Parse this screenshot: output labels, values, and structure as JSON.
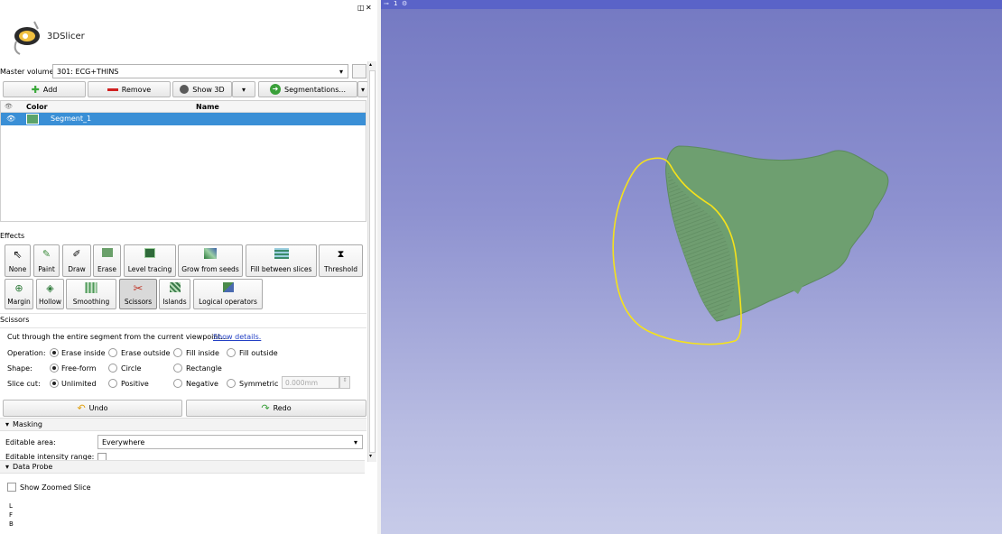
{
  "app": {
    "title": "3DSlicer"
  },
  "panel_controls": {
    "undock": "◫",
    "close": "✕"
  },
  "master_volume": {
    "label": "Master volume:",
    "value": "301: ECG+THINS"
  },
  "toolbar": {
    "add": "Add",
    "remove": "Remove",
    "show3d": "Show 3D",
    "segmentations": "Segmentations..."
  },
  "segments_table": {
    "columns": [
      "Color",
      "Name"
    ],
    "rows": [
      {
        "color": "#5aa36a",
        "name": "Segment_1"
      }
    ]
  },
  "effects": {
    "title": "Effects",
    "row1": [
      "None",
      "Paint",
      "Draw",
      "Erase",
      "Level tracing",
      "Grow from seeds",
      "Fill between slices",
      "Threshold"
    ],
    "row2": [
      "Margin",
      "Hollow",
      "Smoothing",
      "Scissors",
      "Islands",
      "Logical operators"
    ]
  },
  "scissors": {
    "title": "Scissors",
    "description": "Cut through the entire segment from the current viewpoint...",
    "details_link": "Show details.",
    "operation_label": "Operation:",
    "operations": [
      "Erase inside",
      "Erase outside",
      "Fill inside",
      "Fill outside"
    ],
    "shape_label": "Shape:",
    "shapes": [
      "Free-form",
      "Circle",
      "Rectangle"
    ],
    "slice_cut_label": "Slice cut:",
    "slice_cuts": [
      "Unlimited",
      "Positive",
      "Negative",
      "Symmetric"
    ],
    "thickness_value": "0.000mm"
  },
  "undo_redo": {
    "undo": "Undo",
    "redo": "Redo"
  },
  "masking": {
    "title": "Masking",
    "editable_area_label": "Editable area:",
    "editable_area_value": "Everywhere",
    "editable_intensity_label": "Editable intensity range:"
  },
  "data_probe": {
    "title": "Data Probe",
    "show_zoomed_slice": "Show Zoomed Slice",
    "lines": [
      "L",
      "F",
      "B"
    ]
  },
  "view3d": {
    "label": "1",
    "accent": "#5a63c8"
  },
  "colors": {
    "selection": "#3a8fd6",
    "contour": "#f5e21b",
    "model": "#6e9f70"
  }
}
